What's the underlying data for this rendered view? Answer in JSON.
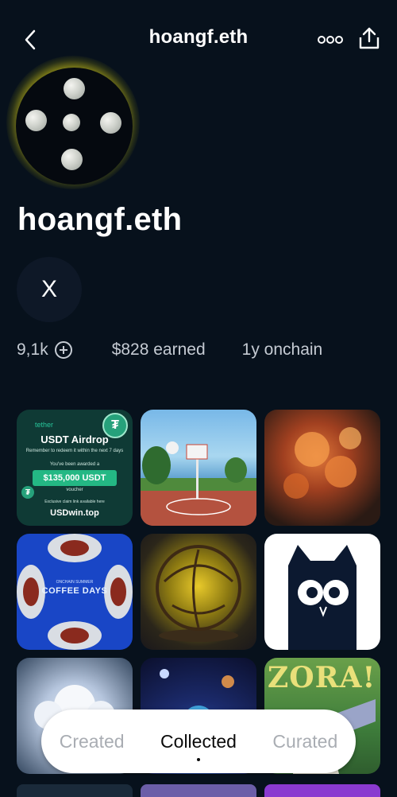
{
  "header": {
    "title": "hoangf.eth"
  },
  "profile": {
    "name": "hoangf.eth",
    "social_label": "X",
    "stats": {
      "followers": "9,1k",
      "earned": "$828 earned",
      "onchain": "1y onchain"
    }
  },
  "grid": {
    "tether": {
      "brand": "tether",
      "title": "USDT Airdrop",
      "subtitle": "Remember to redeem it within the next 7 days",
      "award": "You've been awarded a",
      "amount": "$135,000 USDT",
      "voucher": "voucher",
      "claim": "Exclusive claim link available here",
      "site": "USDwin.top"
    },
    "coffee": {
      "small": "ONCHAIN SUMMER",
      "title": "COFFEE DAYS"
    },
    "zora": {
      "title": "ZORA!"
    }
  },
  "tabs": {
    "created": "Created",
    "collected": "Collected",
    "curated": "Curated",
    "active": "collected"
  },
  "colors": {
    "background": "#07111c",
    "accent_ring": "#f2e43a",
    "tab_bar": "#ffffff"
  },
  "icons": {
    "back": "chevron-left-icon",
    "more": "more-dots-icon",
    "share": "share-upload-icon",
    "follow": "plus-circle-icon"
  }
}
